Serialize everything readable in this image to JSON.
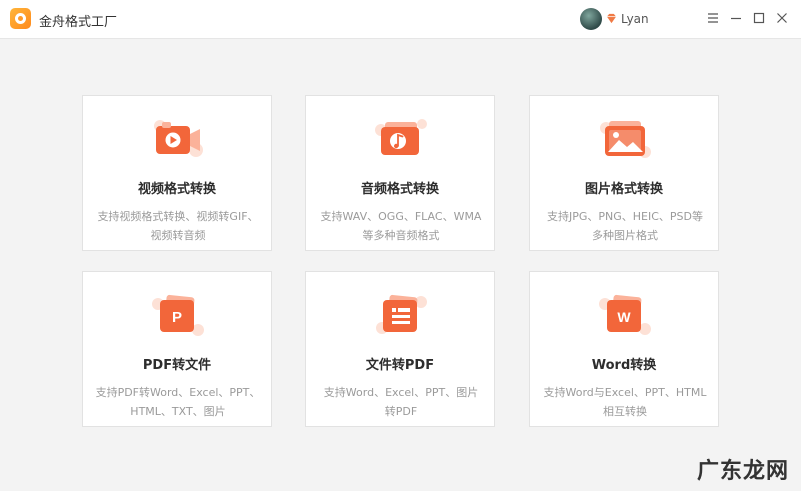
{
  "app": {
    "title": "金舟格式工厂"
  },
  "user": {
    "name": "Lyan"
  },
  "window_controls": {
    "menu_icon": "hamburger-menu-icon",
    "minimize_icon": "minimize-icon",
    "maximize_icon": "maximize-icon",
    "close_icon": "close-icon"
  },
  "cards": [
    {
      "title": "视频格式转换",
      "desc_line1": "支持视频格式转换、视频转GIF、",
      "desc_line2": "视频转音频",
      "icon": "video-camera-icon"
    },
    {
      "title": "音频格式转换",
      "desc_line1": "支持WAV、OGG、FLAC、WMA",
      "desc_line2": "等多种音频格式",
      "icon": "music-note-icon"
    },
    {
      "title": "图片格式转换",
      "desc_line1": "支持JPG、PNG、HEIC、PSD等",
      "desc_line2": "多种图片格式",
      "icon": "image-icon"
    },
    {
      "title": "PDF转文件",
      "desc_line1": "支持PDF转Word、Excel、PPT、",
      "desc_line2": "HTML、TXT、图片",
      "icon": "pdf-p-icon"
    },
    {
      "title": "文件转PDF",
      "desc_line1": "支持Word、Excel、PPT、图片",
      "desc_line2": "转PDF",
      "icon": "document-lines-icon"
    },
    {
      "title": "Word转换",
      "desc_line1": "支持Word与Excel、PPT、HTML",
      "desc_line2": "相互转换",
      "icon": "word-w-icon"
    }
  ],
  "watermark": {
    "text": "广东龙网"
  },
  "colors": {
    "accent": "#f2663a",
    "accent_light": "#fbb29a",
    "background": "#f3f3f3"
  }
}
